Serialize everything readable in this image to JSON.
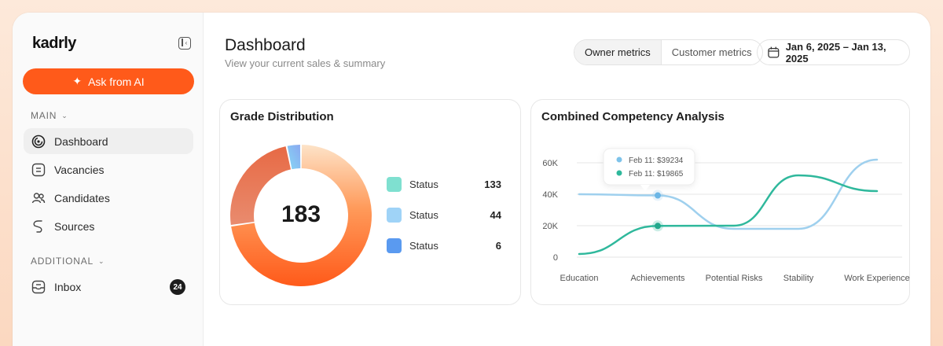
{
  "app": {
    "logo": "kadrly"
  },
  "sidebar": {
    "ask_label": "Ask from AI",
    "main_label": "MAIN",
    "additional_label": "ADDITIONAL",
    "items": [
      {
        "label": "Dashboard",
        "icon": "dashboard-icon",
        "active": true
      },
      {
        "label": "Vacancies",
        "icon": "vacancies-icon"
      },
      {
        "label": "Candidates",
        "icon": "candidates-icon"
      },
      {
        "label": "Sources",
        "icon": "sources-icon"
      }
    ],
    "inbox": {
      "label": "Inbox",
      "icon": "inbox-icon",
      "count": "24"
    }
  },
  "header": {
    "title": "Dashboard",
    "subtitle": "View your current sales & summary",
    "tabs": [
      "Owner metrics",
      "Customer metrics"
    ],
    "date_range": "Jan 6, 2025 – Jan 13, 2025"
  },
  "grade_card": {
    "title": "Grade Distribution",
    "total": "183",
    "legend": [
      {
        "label": "Status",
        "value": "133"
      },
      {
        "label": "Status",
        "value": "44"
      },
      {
        "label": "Status",
        "value": "6"
      }
    ]
  },
  "colors": {
    "accent": "#ff5a1a",
    "legend_teal": "#7fe0d0",
    "legend_lightblue": "#9fd3f7",
    "legend_blue": "#5a9af0",
    "line_blue": "#9fd0ee",
    "line_teal": "#2fb89c"
  },
  "competency_card": {
    "title": "Combined Competency Analysis",
    "tooltip": [
      {
        "label": "Feb 11: $39234"
      },
      {
        "label": "Feb 11: $19865"
      }
    ]
  },
  "chart_data": [
    {
      "type": "pie",
      "title": "Grade Distribution",
      "categories": [
        "Status",
        "Status",
        "Status"
      ],
      "values": [
        133,
        44,
        6
      ]
    },
    {
      "type": "line",
      "title": "Combined Competency Analysis",
      "categories": [
        "Education",
        "Achievements",
        "Potential Risks",
        "Stability",
        "Work Experience"
      ],
      "y_ticks": [
        "0",
        "20K",
        "40K",
        "60K"
      ],
      "ylim": [
        0,
        60000
      ],
      "grid": true,
      "series": [
        {
          "values": [
            40000,
            39234,
            18000,
            18000,
            62000
          ]
        },
        {
          "values": [
            2000,
            19865,
            20000,
            52000,
            42000
          ]
        }
      ]
    }
  ]
}
